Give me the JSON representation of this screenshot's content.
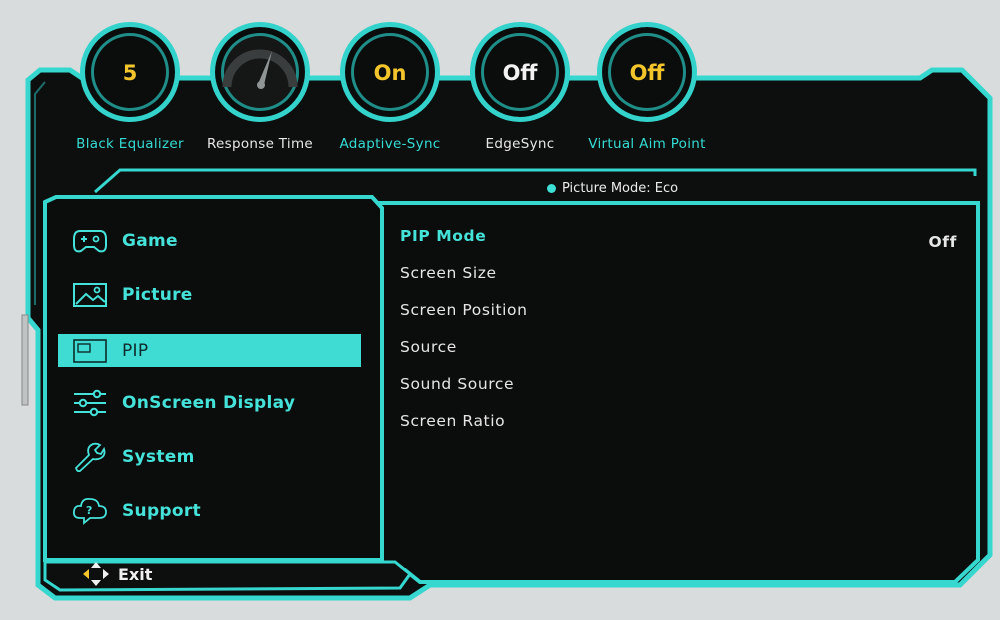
{
  "top_settings": [
    {
      "label": "Black Equalizer",
      "value": "5",
      "value_color": "yellow"
    },
    {
      "label": "Response Time",
      "value": "",
      "gauge": true
    },
    {
      "label": "Adaptive-Sync",
      "value": "On",
      "value_color": "yellow"
    },
    {
      "label": "EdgeSync",
      "value": "Off",
      "value_color": "white"
    },
    {
      "label": "Virtual Aim Point",
      "value": "Off",
      "value_color": "yellow"
    }
  ],
  "picture_mode": "Picture Mode: Eco",
  "menu": [
    {
      "label": "Game",
      "icon": "gamepad-icon"
    },
    {
      "label": "Picture",
      "icon": "picture-icon"
    },
    {
      "label": "PIP",
      "icon": "pip-icon",
      "selected": true
    },
    {
      "label": "OnScreen Display",
      "icon": "sliders-icon"
    },
    {
      "label": "System",
      "icon": "wrench-icon"
    },
    {
      "label": "Support",
      "icon": "help-cloud-icon"
    }
  ],
  "submenu": [
    {
      "label": "PIP Mode",
      "value": "Off",
      "active": true
    },
    {
      "label": "Screen Size"
    },
    {
      "label": "Screen Position"
    },
    {
      "label": "Source"
    },
    {
      "label": "Sound Source"
    },
    {
      "label": "Screen Ratio"
    }
  ],
  "exit_label": "Exit",
  "colors": {
    "accent": "#3fdcd4",
    "panel": "#0b0d0d",
    "highlight_value": "#f3c52b"
  }
}
